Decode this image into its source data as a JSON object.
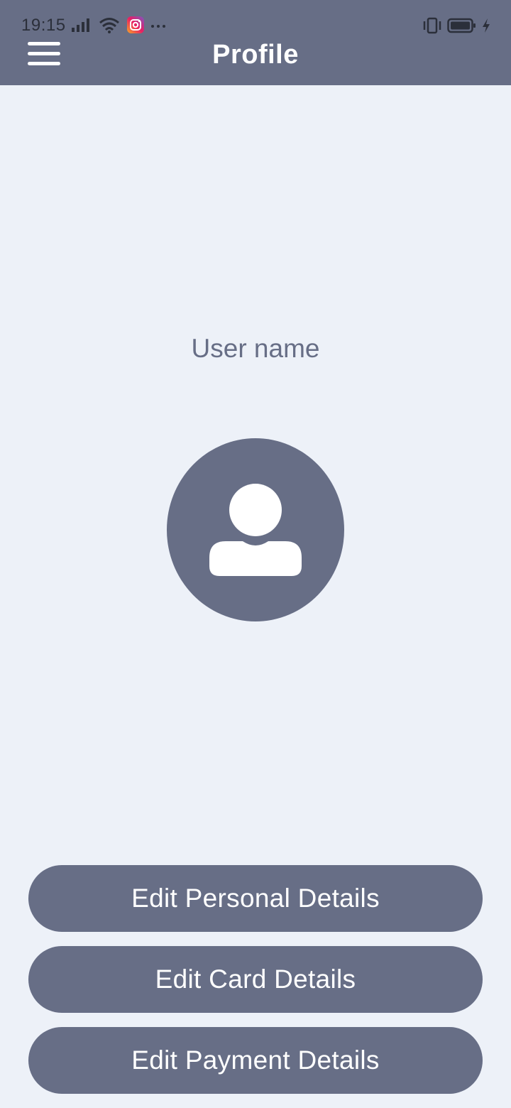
{
  "status_bar": {
    "time": "19:15",
    "icons": [
      "signal-icon",
      "wifi-icon",
      "instagram-icon",
      "more-notifications-icon",
      "vibrate-icon",
      "battery-icon",
      "charging-icon"
    ]
  },
  "header": {
    "title": "Profile",
    "menu_icon": "hamburger-menu-icon"
  },
  "profile": {
    "username": "User name",
    "avatar_icon": "user-avatar-icon"
  },
  "actions": {
    "personal": "Edit Personal Details",
    "card": "Edit Card Details",
    "payment": "Edit Payment Details"
  },
  "colors": {
    "primary": "#676e86",
    "background": "#edf1f8",
    "on_primary": "#ffffff"
  }
}
